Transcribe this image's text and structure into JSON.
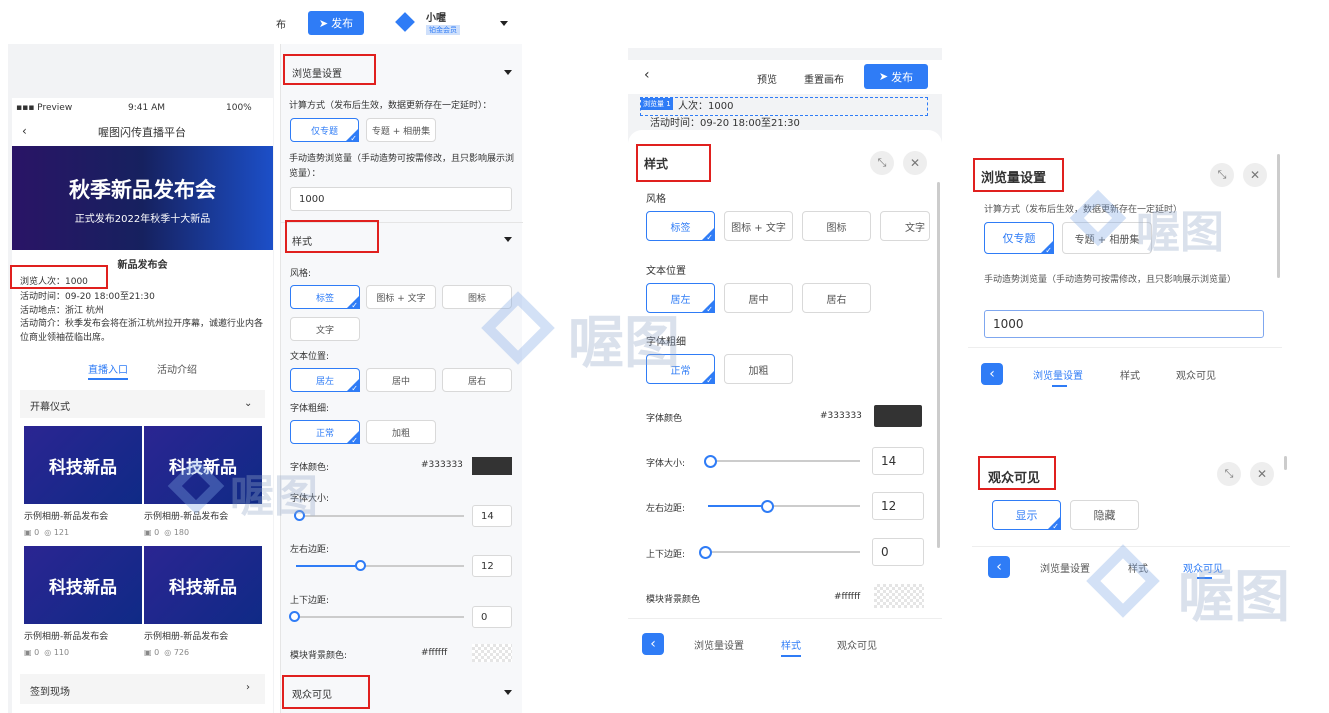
{
  "top": {
    "partial_tab": "布",
    "publish": "发布",
    "user": "小喔",
    "badge": "铂金会员"
  },
  "phone": {
    "carrier": "Preview",
    "time": "9:41 AM",
    "battery": "100%",
    "title": "喔图闪传直播平台",
    "banner_title": "秋季新品发布会",
    "banner_sub": "正式发布2022年秋季十大新品",
    "event_name": "新品发布会",
    "views": "浏览人次：1000",
    "activity_time": "活动时间：09-20 18:00至21:30",
    "location": "活动地点：浙江 杭州",
    "intro": "活动简介：秋季发布会将在浙江杭州拉开序幕，诚邀行业内各位商业领袖莅临出席。",
    "tabs": [
      "直播入口",
      "活动介绍"
    ],
    "section1": "开幕仪式",
    "albums": [
      {
        "cover": "科技新品",
        "name": "示例相册-新品发布会",
        "count": "0",
        "views": "121"
      },
      {
        "cover": "科技新品",
        "name": "示例相册-新品发布会",
        "count": "0",
        "views": "180"
      },
      {
        "cover": "科技新品",
        "name": "示例相册-新品发布会",
        "count": "0",
        "views": "110"
      },
      {
        "cover": "科技新品",
        "name": "示例相册-新品发布会",
        "count": "0",
        "views": "726"
      }
    ],
    "section2": "签到现场"
  },
  "settings": {
    "view_title": "浏览量设置",
    "calc_label": "计算方式（发布后生效，数据更新存在一定延时）：",
    "calc_opts": [
      "仅专题",
      "专题 + 相册集"
    ],
    "manual_label": "手动造势浏览量（手动造势可按需修改，且只影响展示浏览量）：",
    "manual_value": "1000",
    "style_title": "样式",
    "style_label": "风格:",
    "style_opts": [
      "标签",
      "图标 + 文字",
      "图标",
      "文字"
    ],
    "pos_label": "文本位置:",
    "pos_opts": [
      "居左",
      "居中",
      "居右"
    ],
    "weight_label": "字体粗细:",
    "weight_opts": [
      "正常",
      "加粗"
    ],
    "color_label": "字体颜色:",
    "color_value": "#333333",
    "size_label": "字体大小:",
    "size_value": "14",
    "lr_label": "左右边距:",
    "lr_value": "12",
    "tb_label": "上下边距:",
    "tb_value": "0",
    "bg_label": "模块背景颜色:",
    "bg_value": "#ffffff",
    "audience_title": "观众可见"
  },
  "mobile": {
    "preview": "预览",
    "reset": "重置画布",
    "publish": "发布",
    "tag": "浏览量 1",
    "views_partial": "人次：1000",
    "time": "活动时间：09-20 18:00至21:30",
    "style_title": "样式",
    "style_label": "风格",
    "style_opts": [
      "标签",
      "图标 + 文字",
      "图标",
      "文字"
    ],
    "pos_label": "文本位置",
    "pos_opts": [
      "居左",
      "居中",
      "居右"
    ],
    "weight_label": "字体粗细",
    "weight_opts": [
      "正常",
      "加粗"
    ],
    "color_label": "字体颜色",
    "color_value": "#333333",
    "size_label": "字体大小:",
    "size_value": "14",
    "lr_label": "左右边距:",
    "lr_value": "12",
    "tb_label": "上下边距:",
    "tb_value": "0",
    "bg_label": "模块背景颜色",
    "bg_value": "#ffffff",
    "nav": [
      "浏览量设置",
      "样式",
      "观众可见"
    ]
  },
  "right": {
    "view_title": "浏览量设置",
    "calc_label": "计算方式（发布后生效，数据更新存在一定延时）",
    "calc_opts": [
      "仅专题",
      "专题 + 相册集"
    ],
    "manual_label": "手动造势浏览量（手动造势可按需修改，且只影响展示浏览量）",
    "manual_value": "1000",
    "nav": [
      "浏览量设置",
      "样式",
      "观众可见"
    ],
    "aud_title": "观众可见",
    "aud_opts": [
      "显示",
      "隐藏"
    ],
    "nav2": [
      "浏览量设置",
      "样式",
      "观众可见"
    ]
  },
  "watermark": "喔图",
  "colors": {
    "accent": "#2f7cf6",
    "highlight": "#e0201e"
  }
}
